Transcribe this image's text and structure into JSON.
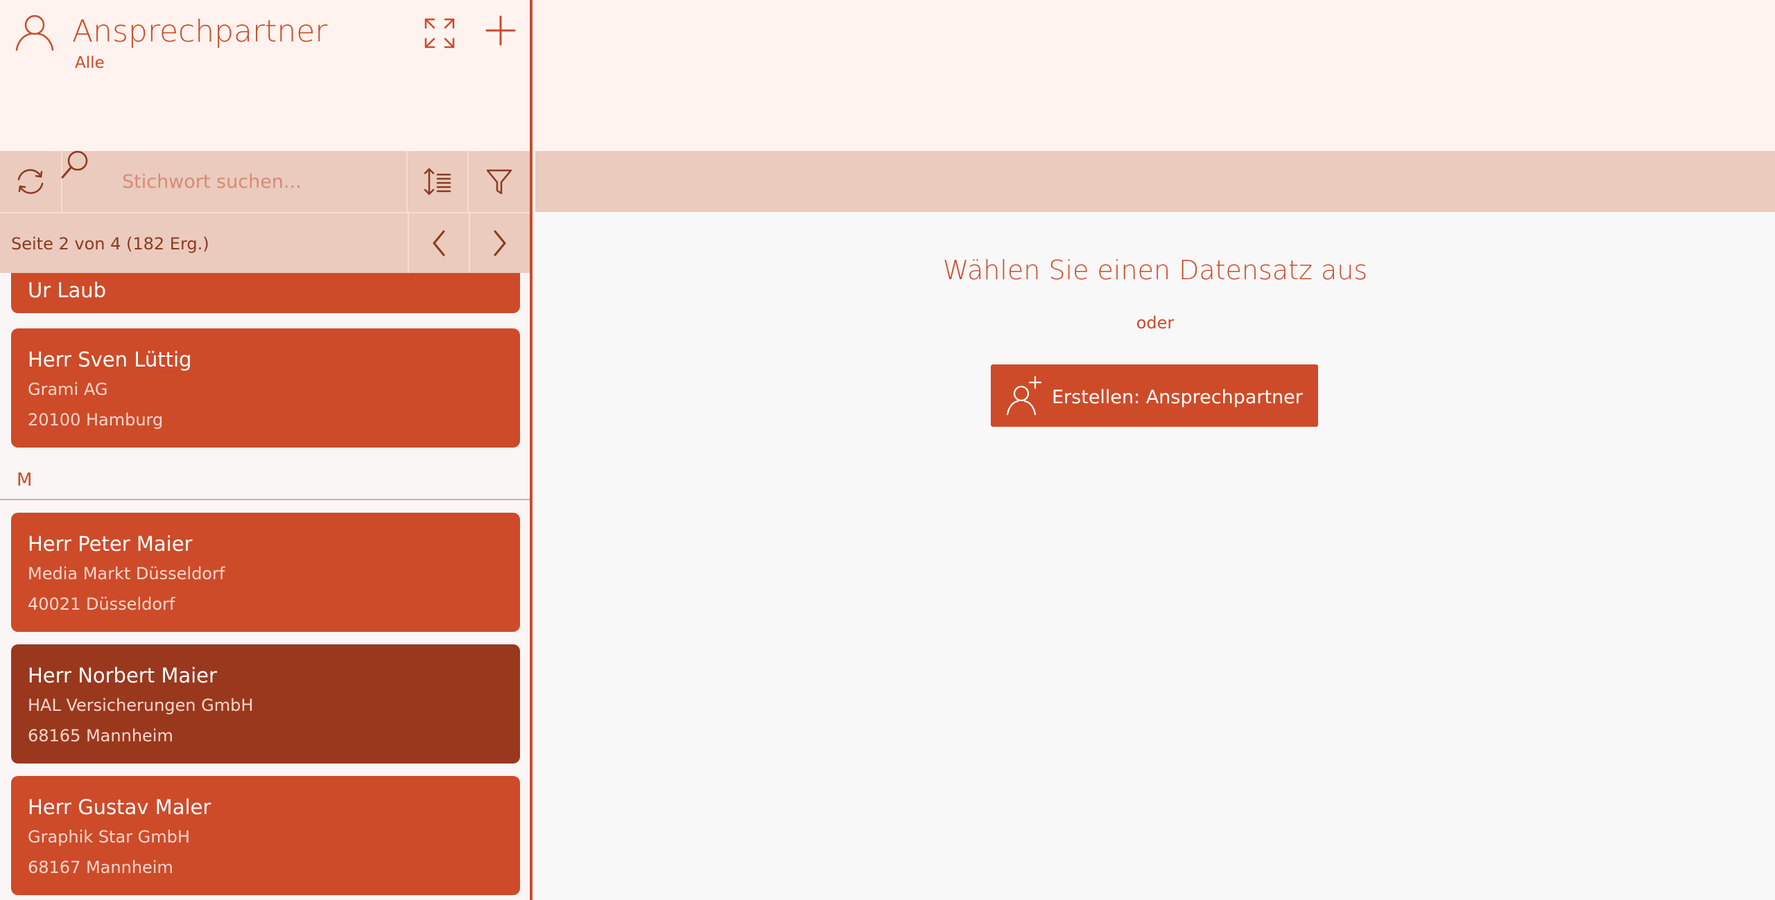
{
  "header": {
    "title": "Ansprechpartner",
    "subtitle": "Alle",
    "icon": "person-icon",
    "expand_icon": "expand-icon",
    "add_icon": "plus-icon"
  },
  "toolbar": {
    "search_placeholder": "Stichwort suchen...",
    "search_value": "",
    "refresh_icon": "refresh-icon",
    "sort_icon": "sort-icon",
    "filter_icon": "filter-icon"
  },
  "pager": {
    "info": "Seite 2 von 4 (182 Erg.)"
  },
  "list": {
    "partial_card": {
      "name": "Ur Laub"
    },
    "cards_L": [
      {
        "name": "Herr Sven Lüttig",
        "company": "Grami AG",
        "city": "20100 Hamburg"
      }
    ],
    "section_M": "M",
    "cards_M": [
      {
        "name": "Herr Peter Maier",
        "company": "Media Markt Düsseldorf",
        "city": "40021 Düsseldorf"
      },
      {
        "name": "Herr Norbert Maier",
        "company": "HAL Versicherungen GmbH",
        "city": "68165 Mannheim"
      },
      {
        "name": "Herr Gustav Maler",
        "company": "Graphik Star GmbH",
        "city": "68167 Mannheim"
      }
    ]
  },
  "main": {
    "empty_title": "Wählen Sie einen Datensatz aus",
    "empty_or": "oder",
    "create_label": "Erstellen: Ansprechpartner",
    "create_icon": "add-person-icon"
  },
  "colors": {
    "accent": "#cc4b2a",
    "card": "#cd4b29",
    "card_selected": "#9a381e",
    "band": "#ebcbbe",
    "header_bg": "#fff3f0"
  }
}
